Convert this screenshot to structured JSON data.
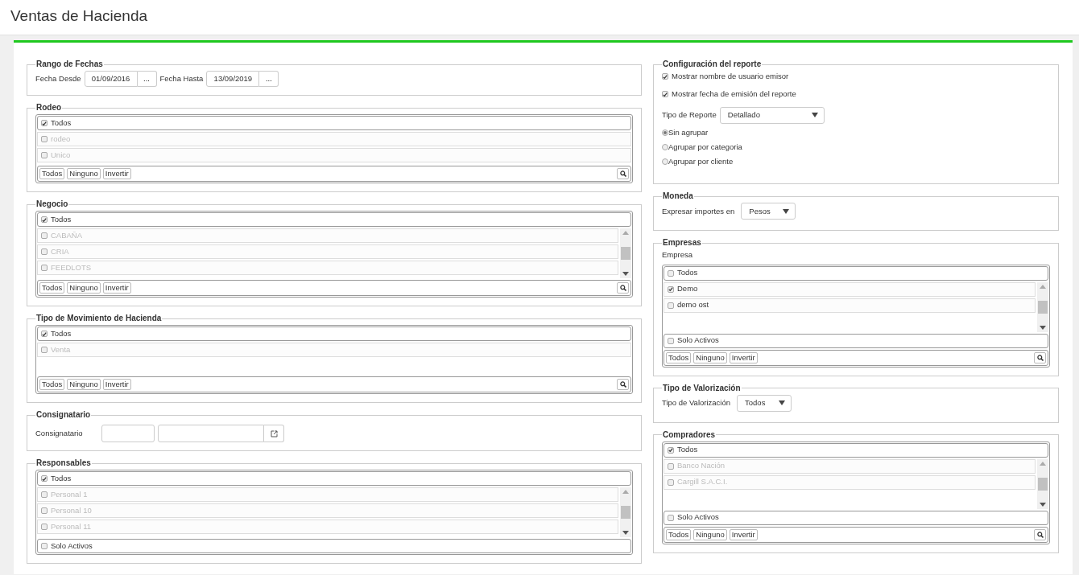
{
  "page_title": "Ventas de Hacienda",
  "columns": [
    {
      "sections": [
        {
          "kind": "daterange",
          "title": "Rango de Fechas",
          "fields": [
            {
              "label": "Fecha Desde",
              "value": "01/09/2016",
              "button": "..."
            },
            {
              "label": "Fecha Hasta",
              "value": "13/09/2019",
              "button": "..."
            }
          ]
        },
        {
          "kind": "checklist",
          "title": "Rodeo",
          "scrollable": false,
          "all": {
            "label": "Todos",
            "checked": true
          },
          "items": [
            {
              "label": "rodeo",
              "checked": false,
              "disabled": true
            },
            {
              "label": "Unico",
              "checked": false,
              "disabled": true
            }
          ],
          "buttons": [
            "Todos",
            "Ninguno",
            "Invertir"
          ]
        },
        {
          "kind": "checklist",
          "title": "Negocio",
          "scrollable": true,
          "all": {
            "label": "Todos",
            "checked": true
          },
          "items": [
            {
              "label": "CABAÑA",
              "checked": false,
              "disabled": true
            },
            {
              "label": "CRIA",
              "checked": false,
              "disabled": true
            },
            {
              "label": "FEEDLOTS",
              "checked": false,
              "disabled": true
            }
          ],
          "buttons": [
            "Todos",
            "Ninguno",
            "Invertir"
          ]
        },
        {
          "kind": "checklist",
          "title": "Tipo de Movimiento de Hacienda",
          "scrollable": false,
          "all": {
            "label": "Todos",
            "checked": true
          },
          "items": [
            {
              "label": "Venta",
              "checked": false,
              "disabled": true
            }
          ],
          "buttons": [
            "Todos",
            "Ninguno",
            "Invertir"
          ]
        },
        {
          "kind": "lookup",
          "title": "Consignatario",
          "label": "Consignatario"
        },
        {
          "kind": "checklist",
          "title": "Responsables",
          "scrollable": true,
          "all": {
            "label": "Todos",
            "checked": true
          },
          "items": [
            {
              "label": "Personal 1",
              "checked": false,
              "disabled": true
            },
            {
              "label": "Personal 10",
              "checked": false,
              "disabled": true
            },
            {
              "label": "Personal 11",
              "checked": false,
              "disabled": true
            }
          ],
          "active_only": {
            "label": "Solo Activos",
            "checked": false
          }
        }
      ]
    },
    {
      "sections": [
        {
          "kind": "config",
          "title": "Configuración del reporte",
          "options": [
            {
              "label": "Mostrar nombre de usuario emisor",
              "checked": true
            },
            {
              "label": "Mostrar fecha de emisión del reporte",
              "checked": true
            }
          ],
          "select": {
            "label": "Tipo de Reporte",
            "value": "Detallado"
          },
          "grouping": [
            {
              "label": "Sin agrupar",
              "selected": true
            },
            {
              "label": "Agrupar por categoria",
              "selected": false
            },
            {
              "label": "Agrupar por cliente",
              "selected": false
            }
          ]
        },
        {
          "kind": "select",
          "title": "Moneda",
          "label": "Expresar importes en",
          "value": "Pesos"
        },
        {
          "kind": "checklist",
          "title": "Empresas",
          "field_label": "Empresa",
          "scrollable": true,
          "all": {
            "label": "Todos",
            "checked": false
          },
          "items": [
            {
              "label": "Demo",
              "checked": true,
              "disabled": false
            },
            {
              "label": "demo ost",
              "checked": false,
              "disabled": false
            }
          ],
          "active_only": {
            "label": "Solo Activos",
            "checked": false
          },
          "buttons": [
            "Todos",
            "Ninguno",
            "Invertir"
          ]
        },
        {
          "kind": "select",
          "title": "Tipo de Valorización",
          "label": "Tipo de Valorización",
          "value": "Todos"
        },
        {
          "kind": "checklist",
          "title": "Compradores",
          "scrollable": true,
          "all": {
            "label": "Todos",
            "checked": true
          },
          "items": [
            {
              "label": "Banco Nación",
              "checked": false,
              "disabled": true
            },
            {
              "label": "Cargill S.A.C.I.",
              "checked": false,
              "disabled": true
            }
          ],
          "active_only": {
            "label": "Solo Activos",
            "checked": false
          },
          "buttons": [
            "Todos",
            "Ninguno",
            "Invertir"
          ]
        }
      ]
    }
  ]
}
